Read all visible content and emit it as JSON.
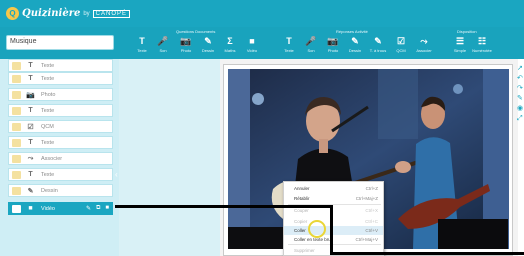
{
  "header": {
    "app_name": "Quizinière",
    "separator": "by",
    "brand": "CANOPÉ"
  },
  "toolbar": {
    "groups": [
      {
        "label": "Questions Documents"
      },
      {
        "label": "Réponses Activité"
      },
      {
        "label": "Disposition"
      }
    ],
    "tools": [
      {
        "icon": "T",
        "icon_name": "text-icon",
        "label": "Texte"
      },
      {
        "icon": "🎤",
        "icon_name": "microphone-icon",
        "label": "Son"
      },
      {
        "icon": "📷",
        "icon_name": "camera-icon",
        "label": "Photo"
      },
      {
        "icon": "✎",
        "icon_name": "pencil-icon",
        "label": "Dessin"
      },
      {
        "icon": "Σ",
        "icon_name": "sigma-icon",
        "label": "Maths"
      },
      {
        "icon": "■",
        "icon_name": "video-icon",
        "label": "Vidéo"
      },
      {
        "icon": "T",
        "icon_name": "text-icon",
        "label": "Texte"
      },
      {
        "icon": "🎤",
        "icon_name": "microphone-icon",
        "label": "Son"
      },
      {
        "icon": "📷",
        "icon_name": "camera-icon",
        "label": "Photo"
      },
      {
        "icon": "✎",
        "icon_name": "pencil-icon",
        "label": "Dessin"
      },
      {
        "icon": "✎",
        "icon_name": "pencil-icon",
        "label": "T. à trous"
      },
      {
        "icon": "☑",
        "icon_name": "checkbox-icon",
        "label": "QCM"
      },
      {
        "icon": "⤳",
        "icon_name": "associate-icon",
        "label": "Associer"
      },
      {
        "icon": "☰",
        "icon_name": "simple-layout-icon",
        "label": "Simple"
      },
      {
        "icon": "☷",
        "icon_name": "numbered-layout-icon",
        "label": "Numérotée"
      }
    ]
  },
  "search": {
    "value": "Musique"
  },
  "items": [
    {
      "icon": "T",
      "icon_name": "text-icon",
      "label": "Texte",
      "selected": false
    },
    {
      "icon": "T",
      "icon_name": "text-icon",
      "label": "Texte",
      "selected": false
    },
    {
      "icon": "📷",
      "icon_name": "camera-icon",
      "label": "Photo",
      "selected": false
    },
    {
      "icon": "T",
      "icon_name": "text-icon",
      "label": "Texte",
      "selected": false
    },
    {
      "icon": "☑",
      "icon_name": "checkbox-icon",
      "label": "QCM",
      "selected": false
    },
    {
      "icon": "T",
      "icon_name": "text-icon",
      "label": "Texte",
      "selected": false
    },
    {
      "icon": "⤳",
      "icon_name": "associate-icon",
      "label": "Associer",
      "selected": false
    },
    {
      "icon": "T",
      "icon_name": "text-icon",
      "label": "Texte",
      "selected": false
    },
    {
      "icon": "✎",
      "icon_name": "pencil-icon",
      "label": "Dessin",
      "selected": false
    },
    {
      "icon": "■",
      "icon_name": "video-icon",
      "label": "Vidéo",
      "selected": true
    }
  ],
  "item_actions": [
    "✎",
    "⧉",
    "■"
  ],
  "context_menu": {
    "items": [
      {
        "label": "Annuler",
        "shortcut": "Ctrl+Z",
        "disabled": false,
        "highlighted": false
      },
      {
        "label": "Rétablir",
        "shortcut": "Ctrl+Maj+Z",
        "disabled": false,
        "highlighted": false
      },
      {
        "label": "Couper",
        "shortcut": "Ctrl+X",
        "disabled": true,
        "highlighted": false
      },
      {
        "label": "Copier",
        "shortcut": "Ctrl+C",
        "disabled": true,
        "highlighted": false
      },
      {
        "label": "Coller",
        "shortcut": "Ctrl+V",
        "disabled": false,
        "highlighted": true
      },
      {
        "label": "Coller en texte brut",
        "shortcut": "Ctrl+Maj+V",
        "disabled": false,
        "highlighted": false
      },
      {
        "label": "Supprimer",
        "shortcut": "",
        "disabled": true,
        "highlighted": false
      }
    ]
  },
  "colors": {
    "accent": "#1aa6c1",
    "panel": "#cfeef5",
    "annotation": "#000000",
    "cursor_ring": "#ead637"
  }
}
